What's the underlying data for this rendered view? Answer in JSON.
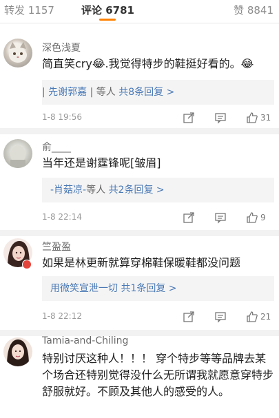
{
  "tabs": {
    "repost": "转发 1157",
    "comment_label": "评论",
    "comment_count": "6781",
    "like": "赞 8841"
  },
  "comments": [
    {
      "name": "深色浅夏",
      "body": "简直笑cry😂.我觉得特步的鞋挺好看的。😂",
      "reply_prefix": "| 先谢郭嘉",
      "reply_sep": " | 等人 ",
      "reply_more": "共8条回复 >",
      "time": "1-8 19:56",
      "likes": "31"
    },
    {
      "name": "俞____",
      "body": "当年还是谢霆锋呢[皱眉]",
      "reply_prefix": "-肖菇凉-",
      "reply_sep": "等人 ",
      "reply_more": "共2条回复 >",
      "time": "1-8 22:14",
      "likes": "9"
    },
    {
      "name": "竺盈盈",
      "body": "如果是林更新就算穿棉鞋保暖鞋都没问题",
      "reply_prefix": "用微笑宣泄一切",
      "reply_sep": " ",
      "reply_more": "共1条回复 >",
      "time": "1-8 22:12",
      "likes": "21"
    },
    {
      "name": "Tamia-and-Chiling",
      "body": "特别讨厌这种人！！！ 穿个特步等等品牌去某个场合还特别觉得没什么无所谓我就愿意穿特步舒服就好。不顾及其他人的感受的人。"
    }
  ],
  "icons": [
    "share-icon",
    "comment-icon",
    "thumb-up-icon"
  ],
  "colors": {
    "accent": "#ff8200",
    "link": "#4a79b5",
    "badge": "#e2433a"
  }
}
